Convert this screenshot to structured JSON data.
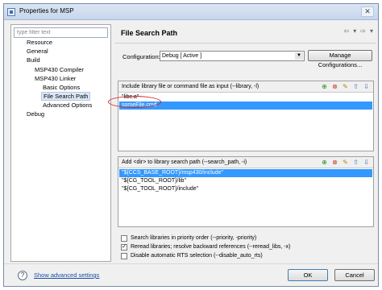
{
  "window": {
    "title": "Properties for MSP",
    "close_glyph": "✕"
  },
  "filter": {
    "placeholder": "type filter text"
  },
  "tree": [
    {
      "label": "Resource",
      "selected": false
    },
    {
      "label": "General",
      "selected": false
    },
    {
      "label": "Build",
      "selected": false
    },
    {
      "label": "MSP430 Compiler",
      "selected": false
    },
    {
      "label": "MSP430 Linker",
      "selected": false
    },
    {
      "label": "Basic Options",
      "selected": false
    },
    {
      "label": "File Search Path",
      "selected": true
    },
    {
      "label": "Advanced Options",
      "selected": false
    },
    {
      "label": "Debug",
      "selected": false
    }
  ],
  "page": {
    "title": "File Search Path",
    "nav_icons": [
      "back-arrow-icon",
      "chevron-down-icon",
      "forward-arrow-icon",
      "chevron-down-icon"
    ]
  },
  "config": {
    "label": "Configuration:",
    "value": "Debug  [ Active ]",
    "manage_button": "Manage Configurations..."
  },
  "include_panel": {
    "title": "Include library file or command file as input (--library, -l)",
    "items": [
      "\"libc.a\"",
      "someFile.cmd"
    ],
    "selected_index": 1
  },
  "search_panel": {
    "title": "Add <dir> to library search path (--search_path, -i)",
    "items": [
      "\"${CCS_BASE_ROOT}/msp430/include\"",
      "\"${CG_TOOL_ROOT}/lib\"",
      "\"${CG_TOOL_ROOT}/include\""
    ],
    "selected_index": 0
  },
  "panel_tools": [
    "add-icon",
    "delete-icon",
    "edit-icon",
    "move-up-icon",
    "move-down-icon"
  ],
  "options": [
    {
      "label": "Search libraries in priority order (--priority, -priority)",
      "checked": false
    },
    {
      "label": "Reread libraries; resolve backward references (--reread_libs, -x)",
      "checked": true
    },
    {
      "label": "Disable automatic RTS selection (--disable_auto_rts)",
      "checked": false
    }
  ],
  "footer": {
    "help_glyph": "?",
    "advanced_link": "Show advanced settings",
    "ok": "OK",
    "cancel": "Cancel"
  },
  "colors": {
    "selection": "#3399ff",
    "annotation": "#d62020",
    "link": "#1b4fa3"
  }
}
